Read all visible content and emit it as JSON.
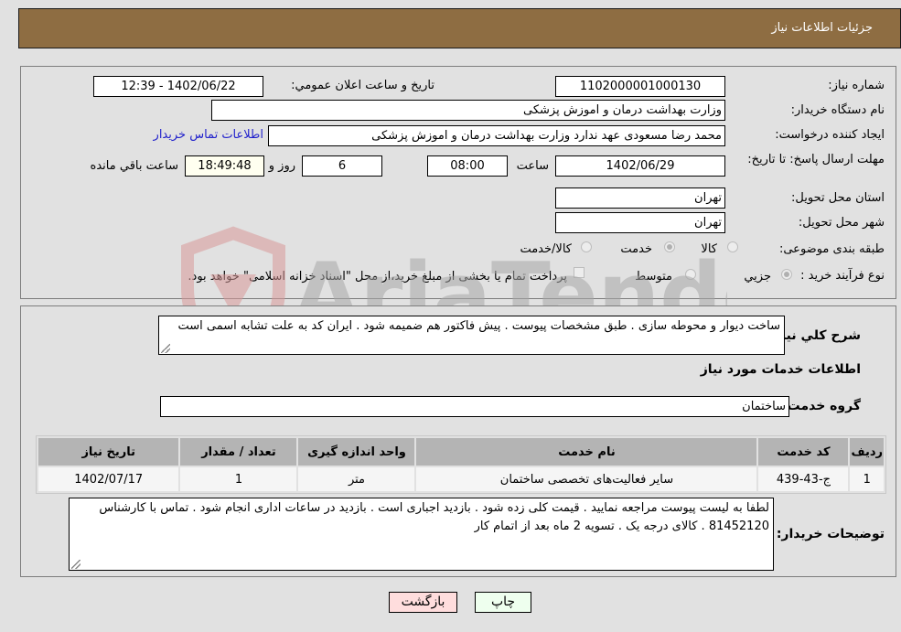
{
  "header": {
    "title": "جزئیات اطلاعات نیاز"
  },
  "fields": {
    "need_number": {
      "label": "شماره نیاز:",
      "value": "1102000001000130"
    },
    "announce_datetime": {
      "label": "تاریخ و ساعت اعلان عمومي:",
      "value": "1402/06/22 - 12:39"
    },
    "buyer_org": {
      "label": "نام دستگاه خریدار:",
      "value": "وزارت بهداشت  درمان و اموزش پزشکی"
    },
    "creator": {
      "label": "ایجاد کننده درخواست:",
      "value": "محمد رضا مسعودی عهد ندارد وزارت بهداشت  درمان و اموزش پزشکی"
    },
    "buyer_contact_link": "اطلاعات تماس خریدار",
    "deadline": {
      "label": "مهلت ارسال پاسخ: تا تاریخ:",
      "date": "1402/06/29",
      "time_label": "ساعت",
      "time": "08:00",
      "days": "6",
      "days_label": "روز و",
      "remaining": "18:49:48",
      "remaining_label": "ساعت باقي مانده"
    },
    "province": {
      "label": "استان محل تحویل:",
      "value": "تهران"
    },
    "city": {
      "label": "شهر محل تحویل:",
      "value": "تهران"
    },
    "category": {
      "label": "طبقه بندی موضوعی:",
      "options": [
        "کالا",
        "خدمت",
        "کالا/خدمت"
      ],
      "selected": "خدمت"
    },
    "process_type": {
      "label": "نوع فرآیند خرید :",
      "options": [
        "جزيي",
        "متوسط"
      ],
      "selected": "جزيي",
      "treasury_checkbox_label": "پرداخت تمام یا بخشی از مبلغ خرید،از محل \"اسناد خزانه اسلامی\" خواهد بود.",
      "treasury_checked": false
    }
  },
  "description": {
    "label": "شرح کلي نیاز:",
    "value": "ساخت دیوار و محوطه سازی . طبق مشخصات پیوست . پیش فاکتور هم ضمیمه شود . ایران کد به علت تشابه اسمی است"
  },
  "services_section": {
    "title": "اطلاعات خدمات مورد نیاز",
    "group_label": "گروه خدمت:",
    "group_value": "ساختمان",
    "table": {
      "headers": [
        "ردیف",
        "کد خدمت",
        "نام خدمت",
        "واحد اندازه گیری",
        "تعداد / مقدار",
        "تاریخ نیاز"
      ],
      "rows": [
        [
          "1",
          "ج-43-439",
          "سایر فعالیت‌های تخصصی ساختمان",
          "متر",
          "1",
          "1402/07/17"
        ]
      ]
    }
  },
  "buyer_notes": {
    "label": "توضیحات خریدار:",
    "value": "لطفا به لیست پیوست مراجعه نمایید . قیمت کلی زده شود . بازدید اجباری است . بازدید در ساعات اداری انجام شود . تماس با کارشناس 81452120 . کالای درجه یک . تسویه 2 ماه بعد از اتمام کار"
  },
  "buttons": {
    "print": "چاپ",
    "back": "بازگشت"
  },
  "watermark": {
    "text": "AriaTender.neT"
  },
  "colors": {
    "header_bg": "#8e6d42",
    "print_bg": "#eeffee",
    "back_bg": "#ffdddd",
    "link": "#2222cc"
  }
}
